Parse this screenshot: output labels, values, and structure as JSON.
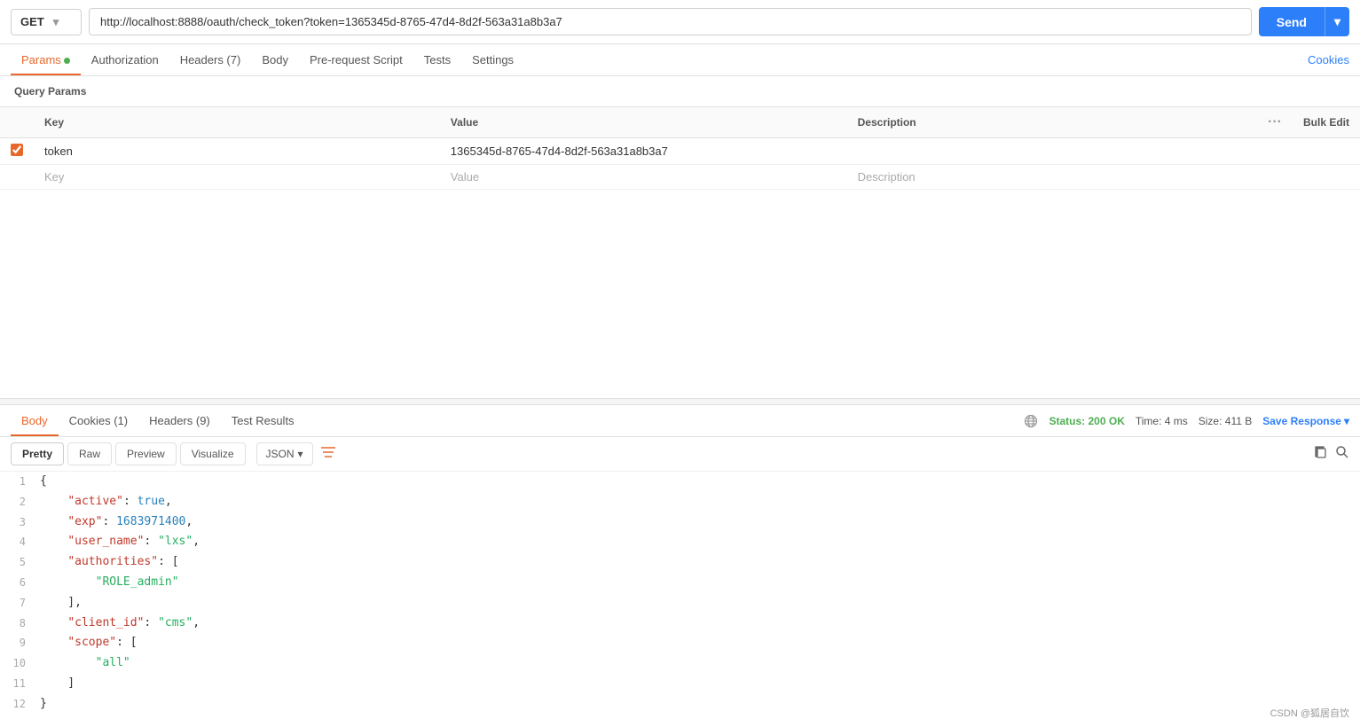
{
  "topbar": {
    "method": "GET",
    "url": "http://localhost:8888/oauth/check_token?token=1365345d-8765-47d4-8d2f-563a31a8b3a7",
    "send_label": "Send"
  },
  "request_tabs": [
    {
      "id": "params",
      "label": "Params",
      "dot": true,
      "active": true
    },
    {
      "id": "authorization",
      "label": "Authorization",
      "active": false
    },
    {
      "id": "headers",
      "label": "Headers (7)",
      "active": false
    },
    {
      "id": "body",
      "label": "Body",
      "active": false
    },
    {
      "id": "prerequest",
      "label": "Pre-request Script",
      "active": false
    },
    {
      "id": "tests",
      "label": "Tests",
      "active": false
    },
    {
      "id": "settings",
      "label": "Settings",
      "active": false
    }
  ],
  "cookies_label": "Cookies",
  "query_params_title": "Query Params",
  "params_table": {
    "columns": [
      "Key",
      "Value",
      "Description"
    ],
    "bulk_edit_label": "Bulk Edit",
    "rows": [
      {
        "checked": true,
        "key": "token",
        "value": "1365345d-8765-47d4-8d2f-563a31a8b3a7",
        "description": ""
      }
    ],
    "empty_row": {
      "key_placeholder": "Key",
      "value_placeholder": "Value",
      "desc_placeholder": "Description"
    }
  },
  "response": {
    "tabs": [
      {
        "id": "body",
        "label": "Body",
        "active": true
      },
      {
        "id": "cookies",
        "label": "Cookies (1)",
        "active": false
      },
      {
        "id": "headers",
        "label": "Headers (9)",
        "active": false
      },
      {
        "id": "test_results",
        "label": "Test Results",
        "active": false
      }
    ],
    "status": "200 OK",
    "time": "4 ms",
    "size": "411 B",
    "save_response_label": "Save Response",
    "format_tabs": [
      {
        "id": "pretty",
        "label": "Pretty",
        "active": true
      },
      {
        "id": "raw",
        "label": "Raw",
        "active": false
      },
      {
        "id": "preview",
        "label": "Preview",
        "active": false
      },
      {
        "id": "visualize",
        "label": "Visualize",
        "active": false
      }
    ],
    "format_select": "JSON",
    "code_lines": [
      {
        "num": 1,
        "content": "{",
        "type": "brace"
      },
      {
        "num": 2,
        "content": "    \"active\": true,",
        "key": "active",
        "value": "true",
        "type": "bool_line"
      },
      {
        "num": 3,
        "content": "    \"exp\": 1683971400,",
        "key": "exp",
        "value": "1683971400",
        "type": "num_line"
      },
      {
        "num": 4,
        "content": "    \"user_name\": \"lxs\",",
        "key": "user_name",
        "value": "lxs",
        "type": "str_line"
      },
      {
        "num": 5,
        "content": "    \"authorities\": [",
        "key": "authorities",
        "type": "arr_open"
      },
      {
        "num": 6,
        "content": "        \"ROLE_admin\"",
        "value": "ROLE_admin",
        "type": "arr_str"
      },
      {
        "num": 7,
        "content": "    ],",
        "type": "arr_close"
      },
      {
        "num": 8,
        "content": "    \"client_id\": \"cms\",",
        "key": "client_id",
        "value": "cms",
        "type": "str_line"
      },
      {
        "num": 9,
        "content": "    \"scope\": [",
        "key": "scope",
        "type": "arr_open"
      },
      {
        "num": 10,
        "content": "        \"all\"",
        "value": "all",
        "type": "arr_str"
      },
      {
        "num": 11,
        "content": "    ]",
        "type": "arr_close_last"
      },
      {
        "num": 12,
        "content": "}",
        "type": "brace"
      }
    ]
  },
  "watermark": "CSDN @狐居自饮"
}
